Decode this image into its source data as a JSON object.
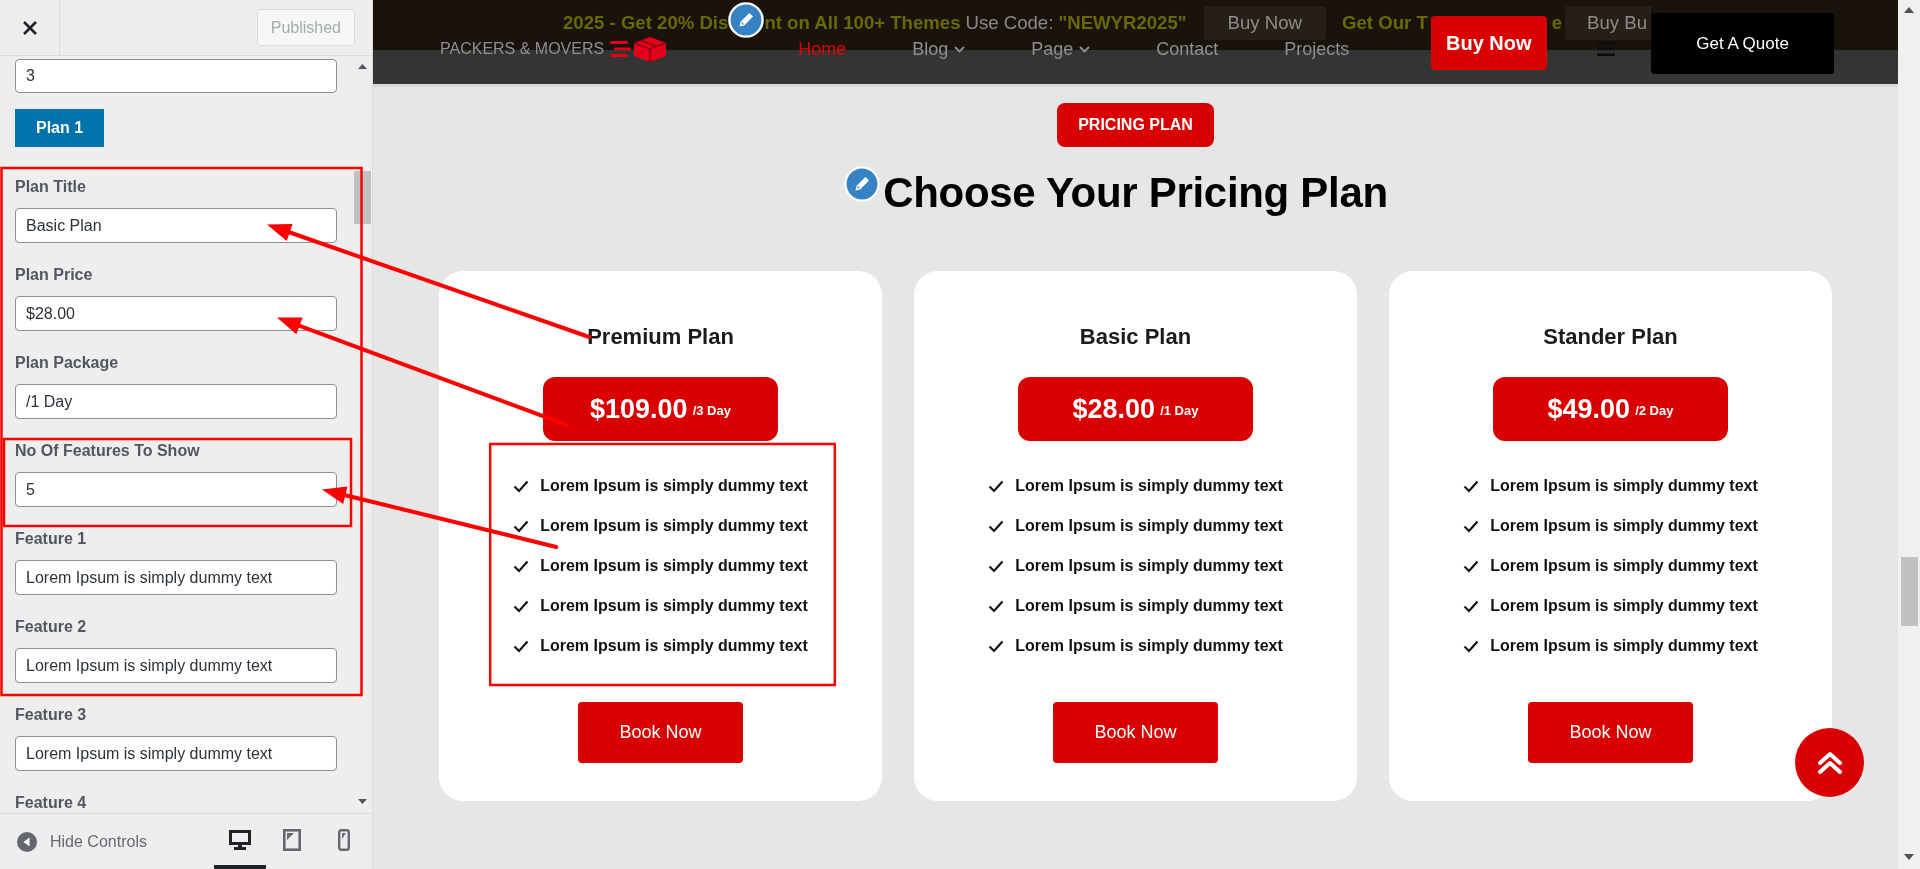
{
  "sidebar": {
    "publish_button": {
      "label": "Published",
      "disabled": true
    },
    "controls": [
      {
        "kind": "input",
        "value": "3"
      },
      {
        "kind": "button",
        "label": "Plan 1"
      },
      {
        "kind": "field",
        "label": "Plan Title",
        "value": "Basic Plan"
      },
      {
        "kind": "field",
        "label": "Plan Price",
        "value": "$28.00"
      },
      {
        "kind": "field",
        "label": "Plan Package",
        "value": "/1 Day"
      },
      {
        "kind": "field",
        "label": "No Of Features To Show",
        "value": "5"
      },
      {
        "kind": "field",
        "label": "Feature 1",
        "value": "Lorem Ipsum is simply dummy text"
      },
      {
        "kind": "field",
        "label": "Feature 2",
        "value": "Lorem Ipsum is simply dummy text"
      },
      {
        "kind": "field",
        "label": "Feature 3",
        "value": "Lorem Ipsum is simply dummy text"
      },
      {
        "kind": "heading",
        "label": "Feature 4"
      }
    ],
    "footer": {
      "toggle_label": "Hide Controls",
      "devices": [
        {
          "kind": "desktop",
          "selected": true
        },
        {
          "kind": "tablet",
          "selected": false
        },
        {
          "kind": "mobile",
          "selected": false
        }
      ]
    }
  },
  "top_bar": {
    "items": [
      {
        "kind": "highlight",
        "text": "2025 - Get 20% Dis"
      },
      {
        "kind": "edit"
      },
      {
        "kind": "highlight",
        "text": "nt on All 100+ Themes"
      },
      {
        "kind": "plain",
        "text": "Use Code:"
      },
      {
        "kind": "highlight",
        "text": "\"NEWYR2025\""
      },
      {
        "kind": "button",
        "text": "Buy Now"
      },
      {
        "kind": "highlight",
        "text": "Get Our T"
      },
      {
        "kind": "cta",
        "text": "Buy Now"
      },
      {
        "kind": "highlight",
        "text": "e"
      },
      {
        "kind": "button",
        "text": "Buy Bu"
      },
      {
        "kind": "dark",
        "text": "Get A Quote"
      }
    ]
  },
  "nav": {
    "brand": "PACKERS & MOVERS",
    "links": [
      {
        "label": "Home",
        "selected": true,
        "dropdown": false
      },
      {
        "label": "Blog",
        "selected": false,
        "dropdown": true
      },
      {
        "label": "Page",
        "selected": false,
        "dropdown": true
      },
      {
        "label": "Contact",
        "selected": false,
        "dropdown": false
      },
      {
        "label": "Projects",
        "selected": false,
        "dropdown": false
      }
    ]
  },
  "pricing": {
    "badge": "PRICING PLAN",
    "title": "Choose Your Pricing Plan",
    "plans": [
      {
        "title": "Premium Plan",
        "price": "$109.00",
        "period": "/3 Day",
        "features": [
          "Lorem Ipsum is simply dummy text",
          "Lorem Ipsum is simply dummy text",
          "Lorem Ipsum is simply dummy text",
          "Lorem Ipsum is simply dummy text",
          "Lorem Ipsum is simply dummy text"
        ],
        "button": "Book Now"
      },
      {
        "title": "Basic Plan",
        "price": "$28.00",
        "period": "/1 Day",
        "features": [
          "Lorem Ipsum is simply dummy text",
          "Lorem Ipsum is simply dummy text",
          "Lorem Ipsum is simply dummy text",
          "Lorem Ipsum is simply dummy text",
          "Lorem Ipsum is simply dummy text"
        ],
        "button": "Book Now"
      },
      {
        "title": "Stander Plan",
        "price": "$49.00",
        "period": "/2 Day",
        "features": [
          "Lorem Ipsum is simply dummy text",
          "Lorem Ipsum is simply dummy text",
          "Lorem Ipsum is simply dummy text",
          "Lorem Ipsum is simply dummy text",
          "Lorem Ipsum is simply dummy text"
        ],
        "button": "Book Now"
      }
    ]
  }
}
